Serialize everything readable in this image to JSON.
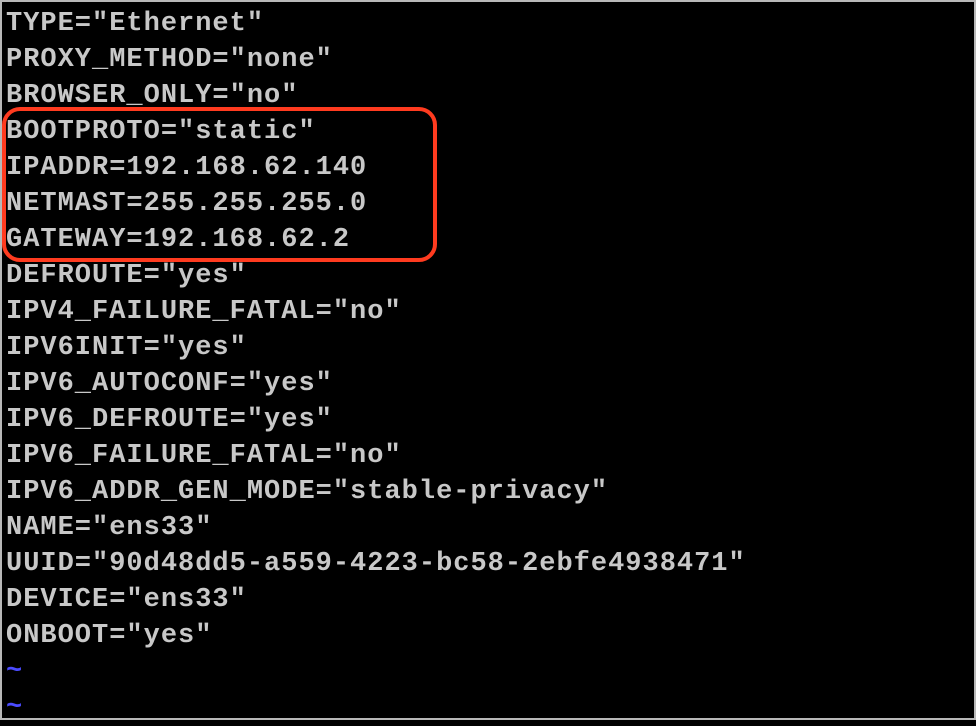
{
  "terminal": {
    "lines": [
      "TYPE=\"Ethernet\"",
      "PROXY_METHOD=\"none\"",
      "BROWSER_ONLY=\"no\"",
      "BOOTPROTO=\"static\"",
      "IPADDR=192.168.62.140",
      "NETMAST=255.255.255.0",
      "GATEWAY=192.168.62.2",
      "DEFROUTE=\"yes\"",
      "IPV4_FAILURE_FATAL=\"no\"",
      "IPV6INIT=\"yes\"",
      "IPV6_AUTOCONF=\"yes\"",
      "IPV6_DEFROUTE=\"yes\"",
      "IPV6_FAILURE_FATAL=\"no\"",
      "IPV6_ADDR_GEN_MODE=\"stable-privacy\"",
      "NAME=\"ens33\"",
      "UUID=\"90d48dd5-a559-4223-bc58-2ebfe4938471\"",
      "DEVICE=\"ens33\"",
      "ONBOOT=\"yes\""
    ],
    "tilde": "~"
  }
}
